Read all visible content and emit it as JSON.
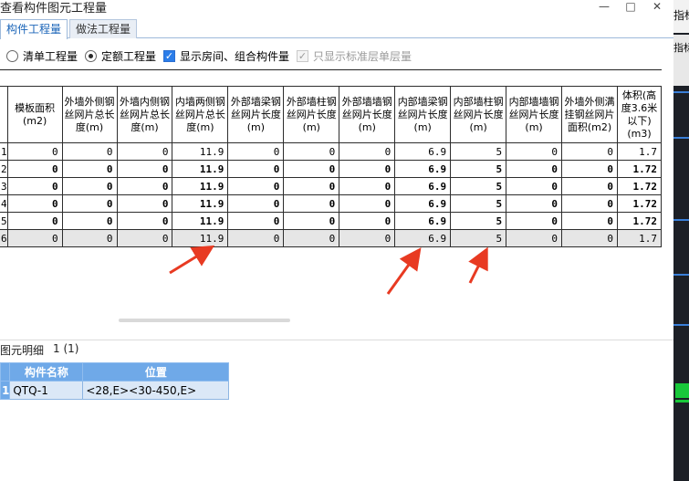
{
  "window": {
    "title": "查看构件图元工程量",
    "minimize_glyph": "—",
    "maximize_glyph": "□",
    "close_glyph": "✕"
  },
  "side": {
    "top_text": "指标",
    "mid_text": "指标"
  },
  "tabs": [
    {
      "label": "构件工程量",
      "active": true
    },
    {
      "label": "做法工程量",
      "active": false
    }
  ],
  "options": {
    "radio_list": "清单工程量",
    "radio_quota": "定额工程量",
    "check_show_rooms": "显示房间、组合构件量",
    "check_standard_only": "只显示标准层单层量"
  },
  "grid": {
    "columns": [
      "模板面积(m2)",
      "外墙外侧钢丝网片总长度(m)",
      "外墙内侧钢丝网片总长度(m)",
      "内墙两侧钢丝网片总长度(m)",
      "外部墙梁钢丝网片长度(m)",
      "外部墙柱钢丝网片长度(m)",
      "外部墙墙钢丝网片长度(m)",
      "内部墙梁钢丝网片长度(m)",
      "内部墙柱钢丝网片长度(m)",
      "内部墙墙钢丝网片长度(m)",
      "外墙外侧满挂钢丝网片面积(m2)",
      "体积(高度3.6米以下)(m3)"
    ],
    "rows": [
      {
        "num": "1",
        "cells": [
          "0",
          "0",
          "0",
          "11.9",
          "0",
          "0",
          "0",
          "6.9",
          "5",
          "0",
          "0",
          "1.7"
        ]
      },
      {
        "num": "2",
        "cells": [
          "0",
          "0",
          "0",
          "11.9",
          "0",
          "0",
          "0",
          "6.9",
          "5",
          "0",
          "0",
          "1.72"
        ]
      },
      {
        "num": "3",
        "cells": [
          "0",
          "0",
          "0",
          "11.9",
          "0",
          "0",
          "0",
          "6.9",
          "5",
          "0",
          "0",
          "1.72"
        ]
      },
      {
        "num": "4",
        "cells": [
          "0",
          "0",
          "0",
          "11.9",
          "0",
          "0",
          "0",
          "6.9",
          "5",
          "0",
          "0",
          "1.72"
        ]
      },
      {
        "num": "5",
        "cells": [
          "0",
          "0",
          "0",
          "11.9",
          "0",
          "0",
          "0",
          "6.9",
          "5",
          "0",
          "0",
          "1.72"
        ]
      },
      {
        "num": "6",
        "cells": [
          "0",
          "0",
          "0",
          "11.9",
          "0",
          "0",
          "0",
          "6.9",
          "5",
          "0",
          "0",
          "1.7"
        ]
      }
    ]
  },
  "detail": {
    "title": "图元明细",
    "count": "1 (1)",
    "headers": [
      "构件名称",
      "位置"
    ],
    "rows": [
      {
        "num": "1",
        "name": "QTQ-1",
        "position": "<28,E><30-450,E>"
      }
    ]
  },
  "colors": {
    "accent": "#2b7de9",
    "header_blue": "#6fa9e8",
    "annotation_red": "#e83a22"
  }
}
